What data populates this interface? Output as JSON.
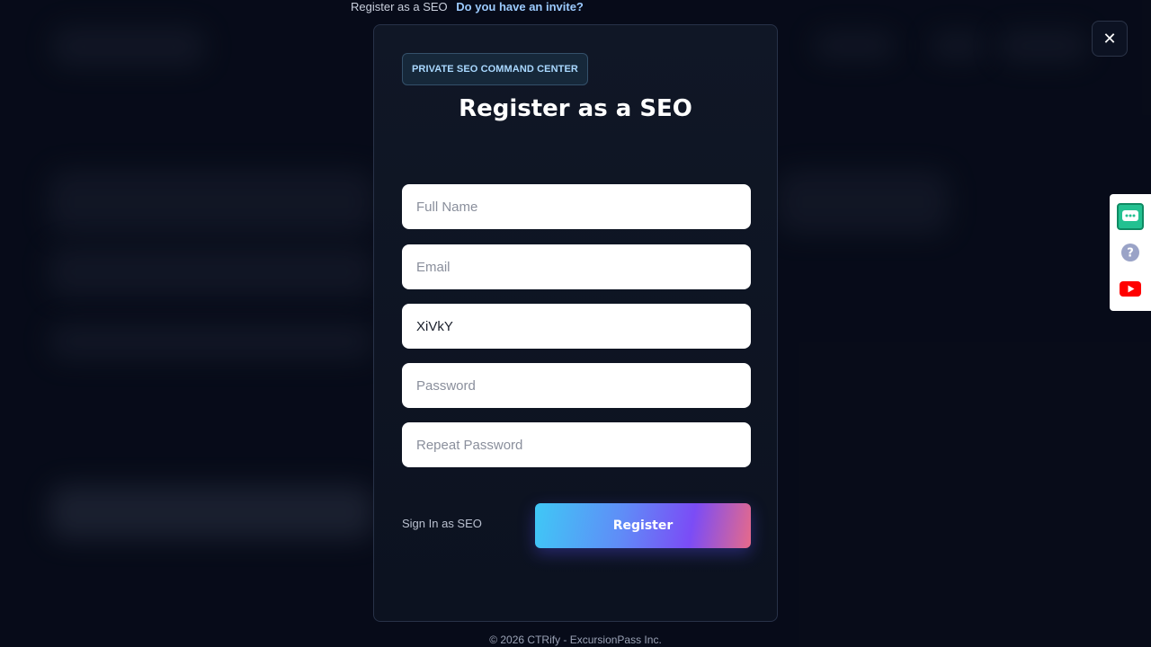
{
  "invite": {
    "lead_text": "Register as a SEO",
    "link_text": "Do you have an invite?"
  },
  "close": {
    "label": "✕"
  },
  "modal": {
    "badge": "PRIVATE SEO COMMAND CENTER",
    "title": "Register as a SEO",
    "fields": {
      "full_name": {
        "placeholder": "Full Name",
        "value": ""
      },
      "email": {
        "placeholder": "Email",
        "value": ""
      },
      "invite_code": {
        "placeholder": "",
        "value": "XiVkY"
      },
      "password": {
        "placeholder": "Password",
        "value": ""
      },
      "repeat_password": {
        "placeholder": "Repeat Password",
        "value": ""
      }
    },
    "signin_label": "Sign In as SEO",
    "register_label": "Register"
  },
  "footer": {
    "copyright": "© 2026 CTRify - ExcursionPass Inc."
  },
  "side_widget": {
    "icons": [
      "chat-icon",
      "help-icon",
      "youtube-icon"
    ],
    "colors": {
      "chat": "#23c191",
      "help": "#9aa3c7",
      "youtube": "#ff0000"
    }
  },
  "theme": {
    "accent_start": "#3fc8f6",
    "accent_mid": "#7b4cf6",
    "accent_end": "#e66a8a",
    "badge_text": "#a9d8ff"
  }
}
